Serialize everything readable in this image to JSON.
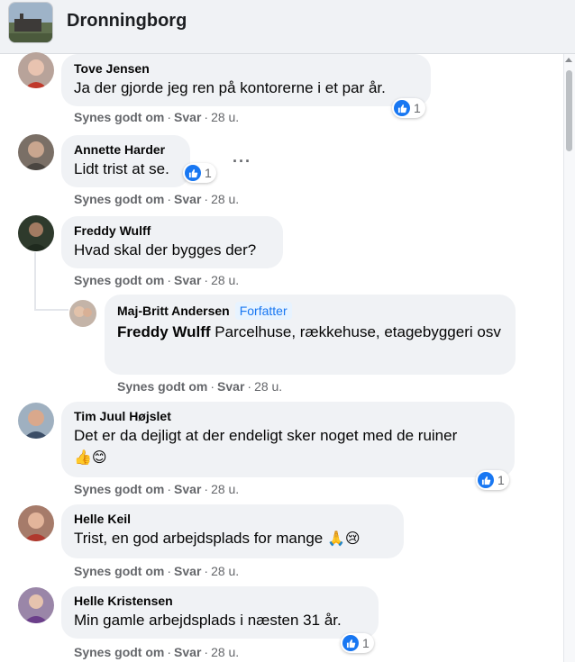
{
  "header": {
    "title": "Dronningborg"
  },
  "actions": {
    "like": "Synes godt om",
    "reply": "Svar",
    "sep": "·"
  },
  "comments": [
    {
      "author": "Tove Jensen",
      "text": "Ja der gjorde jeg ren på kontorerne i et par år.",
      "time": "28 u.",
      "reactions": "1"
    },
    {
      "author": "Annette Harder",
      "text": "Lidt trist at se.",
      "time": "28 u.",
      "reactions": "1",
      "more": "···"
    },
    {
      "author": "Freddy Wulff",
      "text": "Hvad skal der bygges der?",
      "time": "28 u.",
      "reply": {
        "author": "Maj-Britt Andersen",
        "badge": "Forfatter",
        "mention": "Freddy Wulff",
        "text": " Parcelhuse, rækkehuse, etagebyggeri osv",
        "time": "28 u."
      }
    },
    {
      "author": "Tim Juul Højslet",
      "text": "Det er da dejligt at der endeligt sker noget med de ruiner",
      "emojis": "👍😊",
      "time": "28 u.",
      "reactions": "1"
    },
    {
      "author": "Helle Keil",
      "text": "Trist, en god arbejdsplads for mange ",
      "emojis": "🙏😢",
      "time": "28 u."
    },
    {
      "author": "Helle Kristensen",
      "text": "Min gamle arbejdsplads i næsten 31 år.",
      "time": "28 u.",
      "reactions": "1"
    }
  ],
  "colors": {
    "link": "#1877f2",
    "bubble": "#f0f2f5",
    "meta": "#65676b"
  },
  "icons": {
    "reaction": "like-icon",
    "group": "group-cover-image"
  }
}
